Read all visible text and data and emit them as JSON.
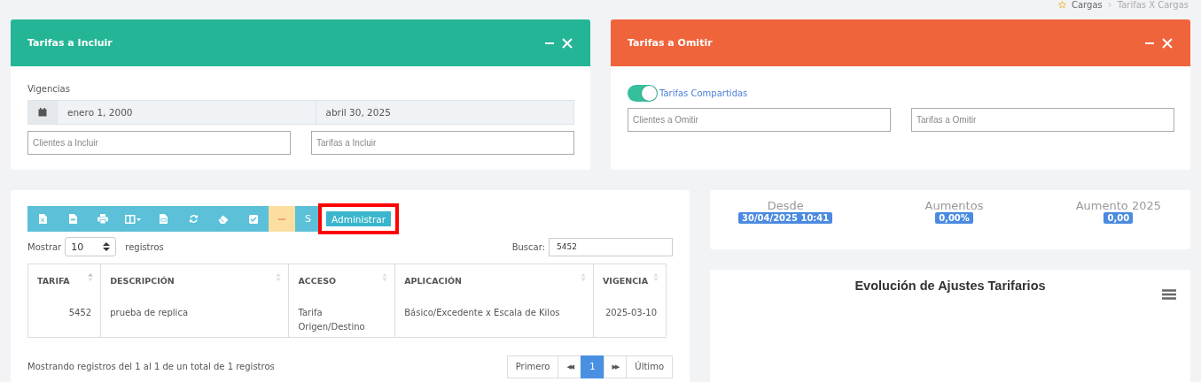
{
  "breadcrumb": [
    "Cargas",
    "Tarifas X Cargas"
  ],
  "include_panel": {
    "title": "Tarifas a Incluir",
    "section_label": "Vigencias",
    "date_from": "enero 1, 2000",
    "date_to": "abril 30, 2025",
    "fields": [
      {
        "placeholder": "Clientes a Incluir"
      },
      {
        "placeholder": "Tarifas a Incluir"
      }
    ]
  },
  "omit_panel": {
    "title": "Tarifas a Omitir",
    "toggle": {
      "label": "Tarifas Compartidas",
      "on": true
    },
    "fields": [
      {
        "placeholder": "Clientes a Omitir"
      },
      {
        "placeholder": "Tarifas a Omitir"
      }
    ]
  },
  "toolbar": [
    {
      "kind": "excel"
    },
    {
      "kind": "pdf"
    },
    {
      "kind": "print"
    },
    {
      "kind": "columns"
    },
    {
      "kind": "csv"
    },
    {
      "kind": "refresh"
    },
    {
      "kind": "eraser"
    },
    {
      "kind": "check"
    },
    {
      "kind": "minus"
    },
    {
      "kind": "text",
      "label": "S"
    },
    {
      "kind": "primary",
      "label": "Administrar",
      "highlighted": true
    }
  ],
  "length": {
    "label_before": "Mostrar",
    "value": "10",
    "label_after": "registros"
  },
  "search": {
    "label": "Buscar:",
    "value": "5452"
  },
  "table": {
    "columns": [
      "TARIFA",
      "DESCRIPCIÓN",
      "ACCESO",
      "APLICACIÓN",
      "VIGENCIA"
    ],
    "rows": [
      [
        "5452",
        "prueba de replica",
        "Tarifa Origen/Destino",
        "Básico/Excedente x Escala de Kilos",
        "2025-03-10"
      ]
    ]
  },
  "info": "Mostrando registros del 1 al 1 de un total de 1 registros",
  "pagination": [
    {
      "label": "Primero",
      "kind": "text",
      "selected": false
    },
    {
      "label": "◀◀",
      "kind": "arrow",
      "selected": false
    },
    {
      "label": "1",
      "kind": "text",
      "selected": true
    },
    {
      "label": "▶▶",
      "kind": "arrow",
      "selected": false
    },
    {
      "label": "Último",
      "kind": "text",
      "selected": false
    }
  ],
  "stats": [
    {
      "label": "Desde",
      "value": "30/04/2025 10:41"
    },
    {
      "label": "Aumentos",
      "value": "0,00%"
    },
    {
      "label": "Aumento 2025",
      "value": "0,00"
    }
  ],
  "chart": {
    "title": "Evolución de Ajustes Tarifarios"
  }
}
